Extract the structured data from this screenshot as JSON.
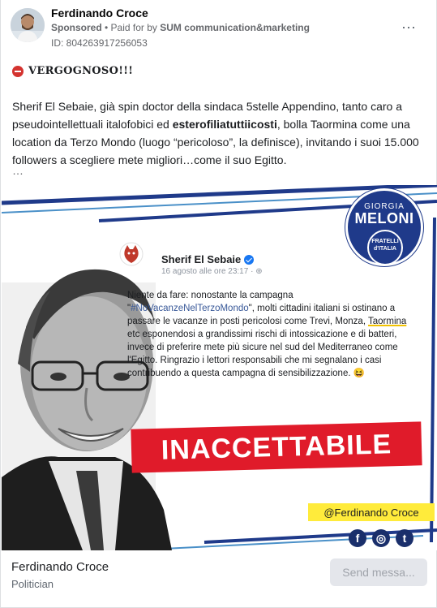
{
  "post": {
    "author": "Ferdinando Croce",
    "sponsored_label": "Sponsored",
    "paid_prefix": "• Paid for by",
    "paid_by": "SUM communication&marketing",
    "id_label": "ID: 804263917256053",
    "more_icon": "⋯",
    "headline": "VERGOGNOSO!!!",
    "body_part1": "Sherif El Sebaie, già spin doctor della sindaca 5stelle Appendino, tanto caro a pseudointellettuali italofobici ed ",
    "body_bold": "esterofiliatuttiicosti",
    "body_part2": ", bolla Taormina come una location da Terzo Mondo (luogo “pericoloso”, la definisce), invitando i suoi 15.000 followers a scegliere mete migliori…come il suo Egitto.",
    "ellipsis": "…"
  },
  "ad": {
    "logo_line1": "GIORGIA",
    "logo_line2": "MELONI",
    "logo_inner_text": "FRATELLI d'ITALIA",
    "tweet_name": "Sherif El Sebaie",
    "tweet_date": "16 agosto alle ore 23:17 · ",
    "tweet_text_1": "Niente da fare: nonostante la campagna \"",
    "tweet_hashtag": "#NoVacanzeNelTerzoMondo",
    "tweet_text_2": "\", molti cittadini italiani si ostinano a passare le vacanze in posti pericolosi come Trevi, Monza, ",
    "tweet_taormina": "Taormina",
    "tweet_text_3": " etc esponendosi a grandissimi rischi di intossicazione e di batteri, invece di preferire mete più sicure nel sud del Mediterraneo come l'Egitto. Ringrazio i lettori responsabili che mi segnalano i casi contribuendo a questa campagna di sensibilizzazione. 😆",
    "stamp_text": "INACCETTABILE",
    "handle": "@Ferdinando Croce",
    "social_fb": "f",
    "social_ig": "◎",
    "social_tw": "t"
  },
  "footer": {
    "page_name": "Ferdinando Croce",
    "page_category": "Politician",
    "send_button": "Send messa..."
  },
  "colors": {
    "stamp_red": "#e01b2a",
    "handle_yellow": "#ffeb3b",
    "brand_blue": "#1f3a8a",
    "link_blue": "#385898"
  }
}
